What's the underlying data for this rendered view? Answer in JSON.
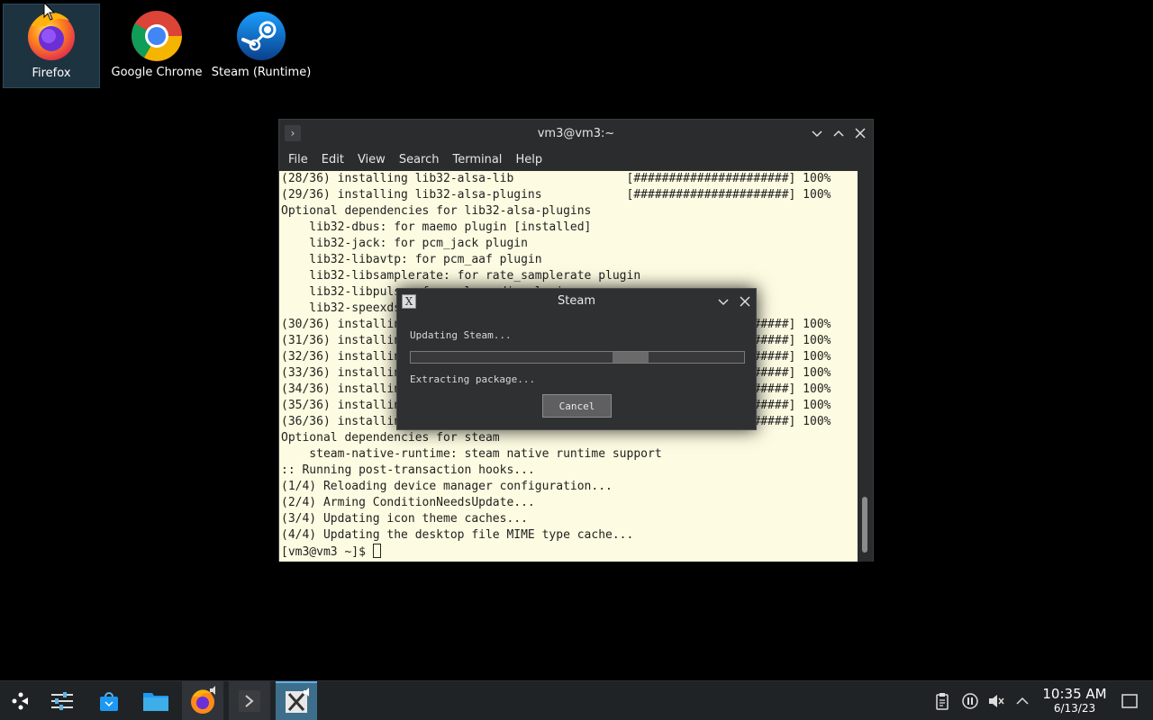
{
  "desktop": {
    "icons": [
      {
        "label": "Firefox"
      },
      {
        "label": "Google Chrome"
      },
      {
        "label": "Steam (Runtime)"
      }
    ]
  },
  "terminal": {
    "title": "vm3@vm3:~",
    "menu": [
      "File",
      "Edit",
      "View",
      "Search",
      "Terminal",
      "Help"
    ],
    "lines": [
      "(28/36) installing lib32-alsa-lib                [######################] 100%",
      "(29/36) installing lib32-alsa-plugins            [######################] 100%",
      "Optional dependencies for lib32-alsa-plugins",
      "    lib32-dbus: for maemo plugin [installed]",
      "    lib32-jack: for pcm_jack plugin",
      "    lib32-libavtp: for pcm_aaf plugin",
      "    lib32-libsamplerate: for rate_samplerate plugin",
      "    lib32-libpulse: for pulseaudio plugin         s",
      "    lib32-speexdsp",
      "(30/36) installing lib32-libnm                   [######################] 100%",
      "(31/36) installing lib32-libva                   [######################] 100%",
      "(32/36) installing lib32-libvdpau                [######################] 100%",
      "(33/36) installing lib32-libxss                  [######################] 100%",
      "(34/36) installing lib32-mesa                    [######################] 100%",
      "(35/36) installing lib32-nss                     [######################] 100%",
      "(36/36) installing steam                         [######################] 100%",
      "Optional dependencies for steam",
      "    steam-native-runtime: steam native runtime support",
      ":: Running post-transaction hooks...",
      "(1/4) Reloading device manager configuration...",
      "(2/4) Arming ConditionNeedsUpdate...",
      "(3/4) Updating icon theme caches...",
      "(4/4) Updating the desktop file MIME type cache...",
      "[vm3@vm3 ~]$ "
    ]
  },
  "steam_dialog": {
    "title": "Steam",
    "status": "Updating Steam...",
    "progress": 0.66,
    "detail": "Extracting package...",
    "cancel_label": "Cancel"
  },
  "taskbar": {
    "time": "10:35 AM",
    "date": "6/13/23"
  }
}
